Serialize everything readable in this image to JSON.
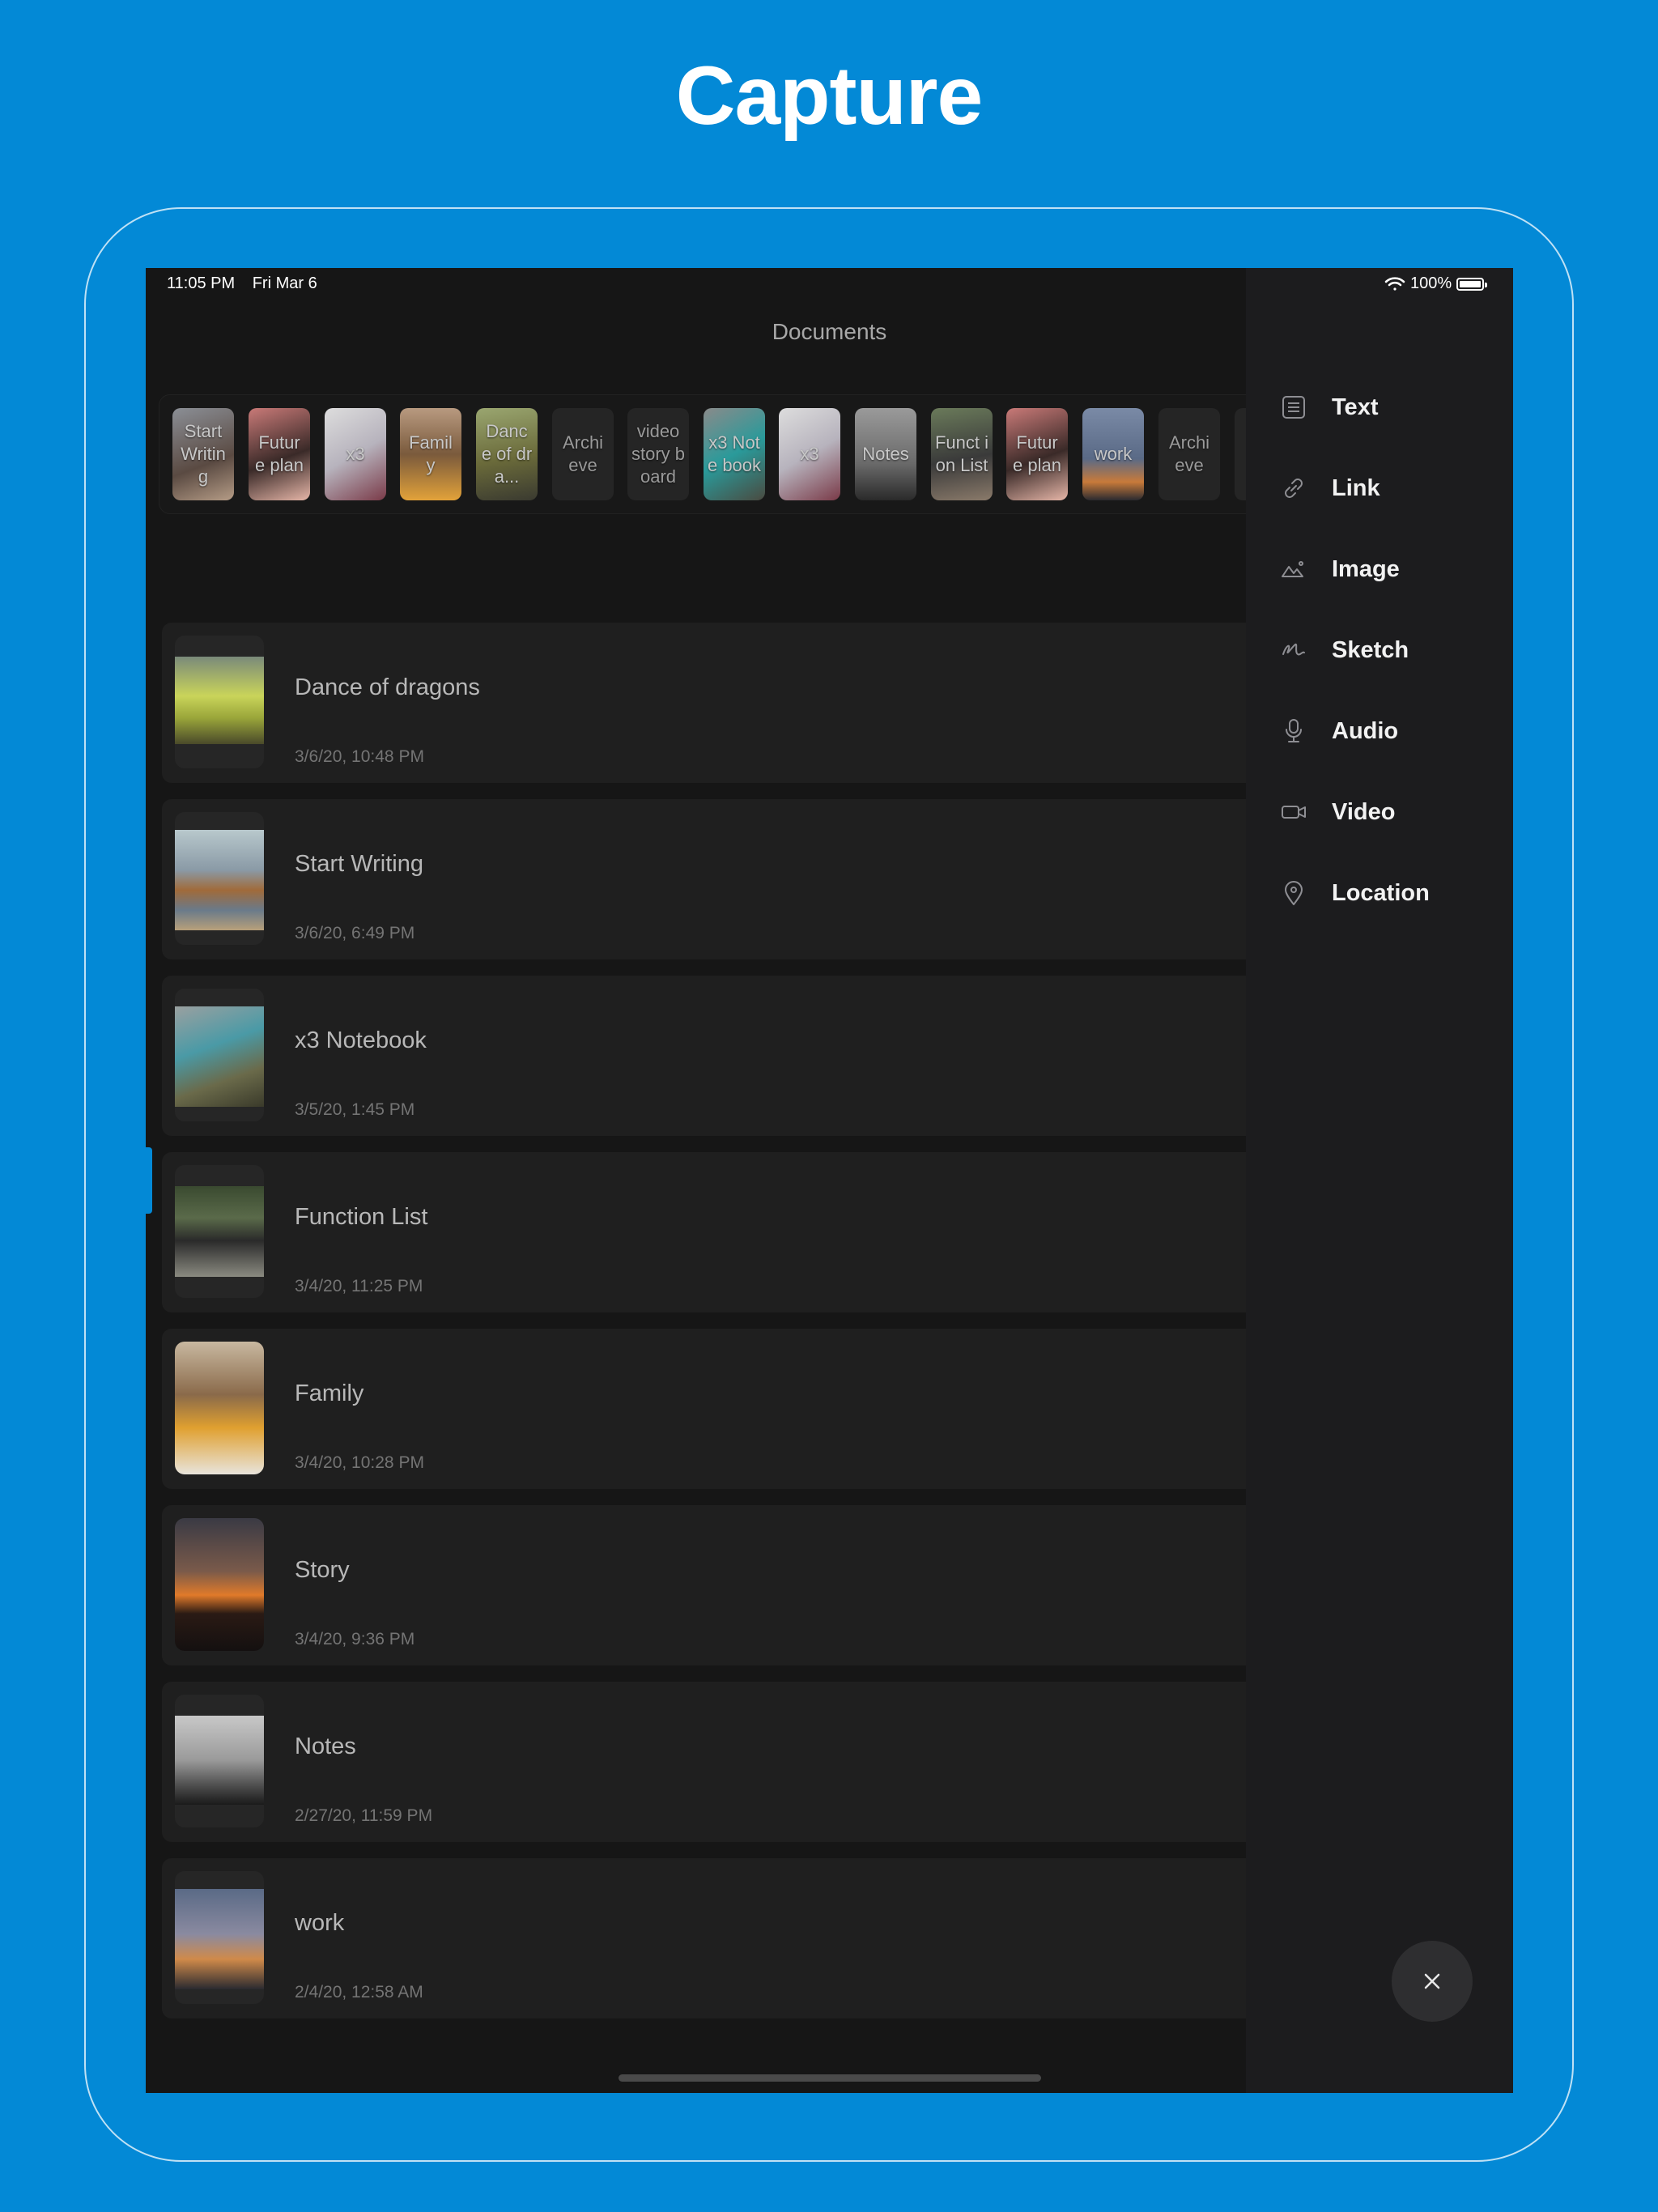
{
  "headline": "Capture",
  "status_bar": {
    "time": "11:05 PM",
    "date": "Fri Mar 6",
    "battery": "100%"
  },
  "nav": {
    "title": "Documents"
  },
  "strip": {
    "items": [
      {
        "label": "Start Writin g"
      },
      {
        "label": "Futur e plan"
      },
      {
        "label": "x3"
      },
      {
        "label": "Famil y"
      },
      {
        "label": "Danc e of dra..."
      },
      {
        "label": "Archi eve"
      },
      {
        "label": "video story board"
      },
      {
        "label": "x3 Note book"
      },
      {
        "label": "x3"
      },
      {
        "label": "Notes"
      },
      {
        "label": "Funct ion List"
      },
      {
        "label": "Futur e plan"
      },
      {
        "label": "work"
      },
      {
        "label": "Archi eve"
      }
    ]
  },
  "documents": [
    {
      "title": "Dance of dragons",
      "date": "3/6/20, 10:48 PM"
    },
    {
      "title": "Start Writing",
      "date": "3/6/20, 6:49 PM"
    },
    {
      "title": "x3 Notebook",
      "date": "3/5/20, 1:45 PM"
    },
    {
      "title": "Function List",
      "date": "3/4/20, 11:25 PM"
    },
    {
      "title": "Family",
      "date": "3/4/20, 10:28 PM"
    },
    {
      "title": "Story",
      "date": "3/4/20, 9:36 PM"
    },
    {
      "title": "Notes",
      "date": "2/27/20, 11:59 PM"
    },
    {
      "title": "work",
      "date": "2/4/20, 12:58 AM"
    }
  ],
  "capture_menu": {
    "items": [
      {
        "label": "Text",
        "icon": "text-icon"
      },
      {
        "label": "Link",
        "icon": "link-icon"
      },
      {
        "label": "Image",
        "icon": "image-icon"
      },
      {
        "label": "Sketch",
        "icon": "sketch-icon"
      },
      {
        "label": "Audio",
        "icon": "microphone-icon"
      },
      {
        "label": "Video",
        "icon": "video-camera-icon"
      },
      {
        "label": "Location",
        "icon": "location-pin-icon"
      }
    ],
    "close_icon": "close-icon"
  }
}
